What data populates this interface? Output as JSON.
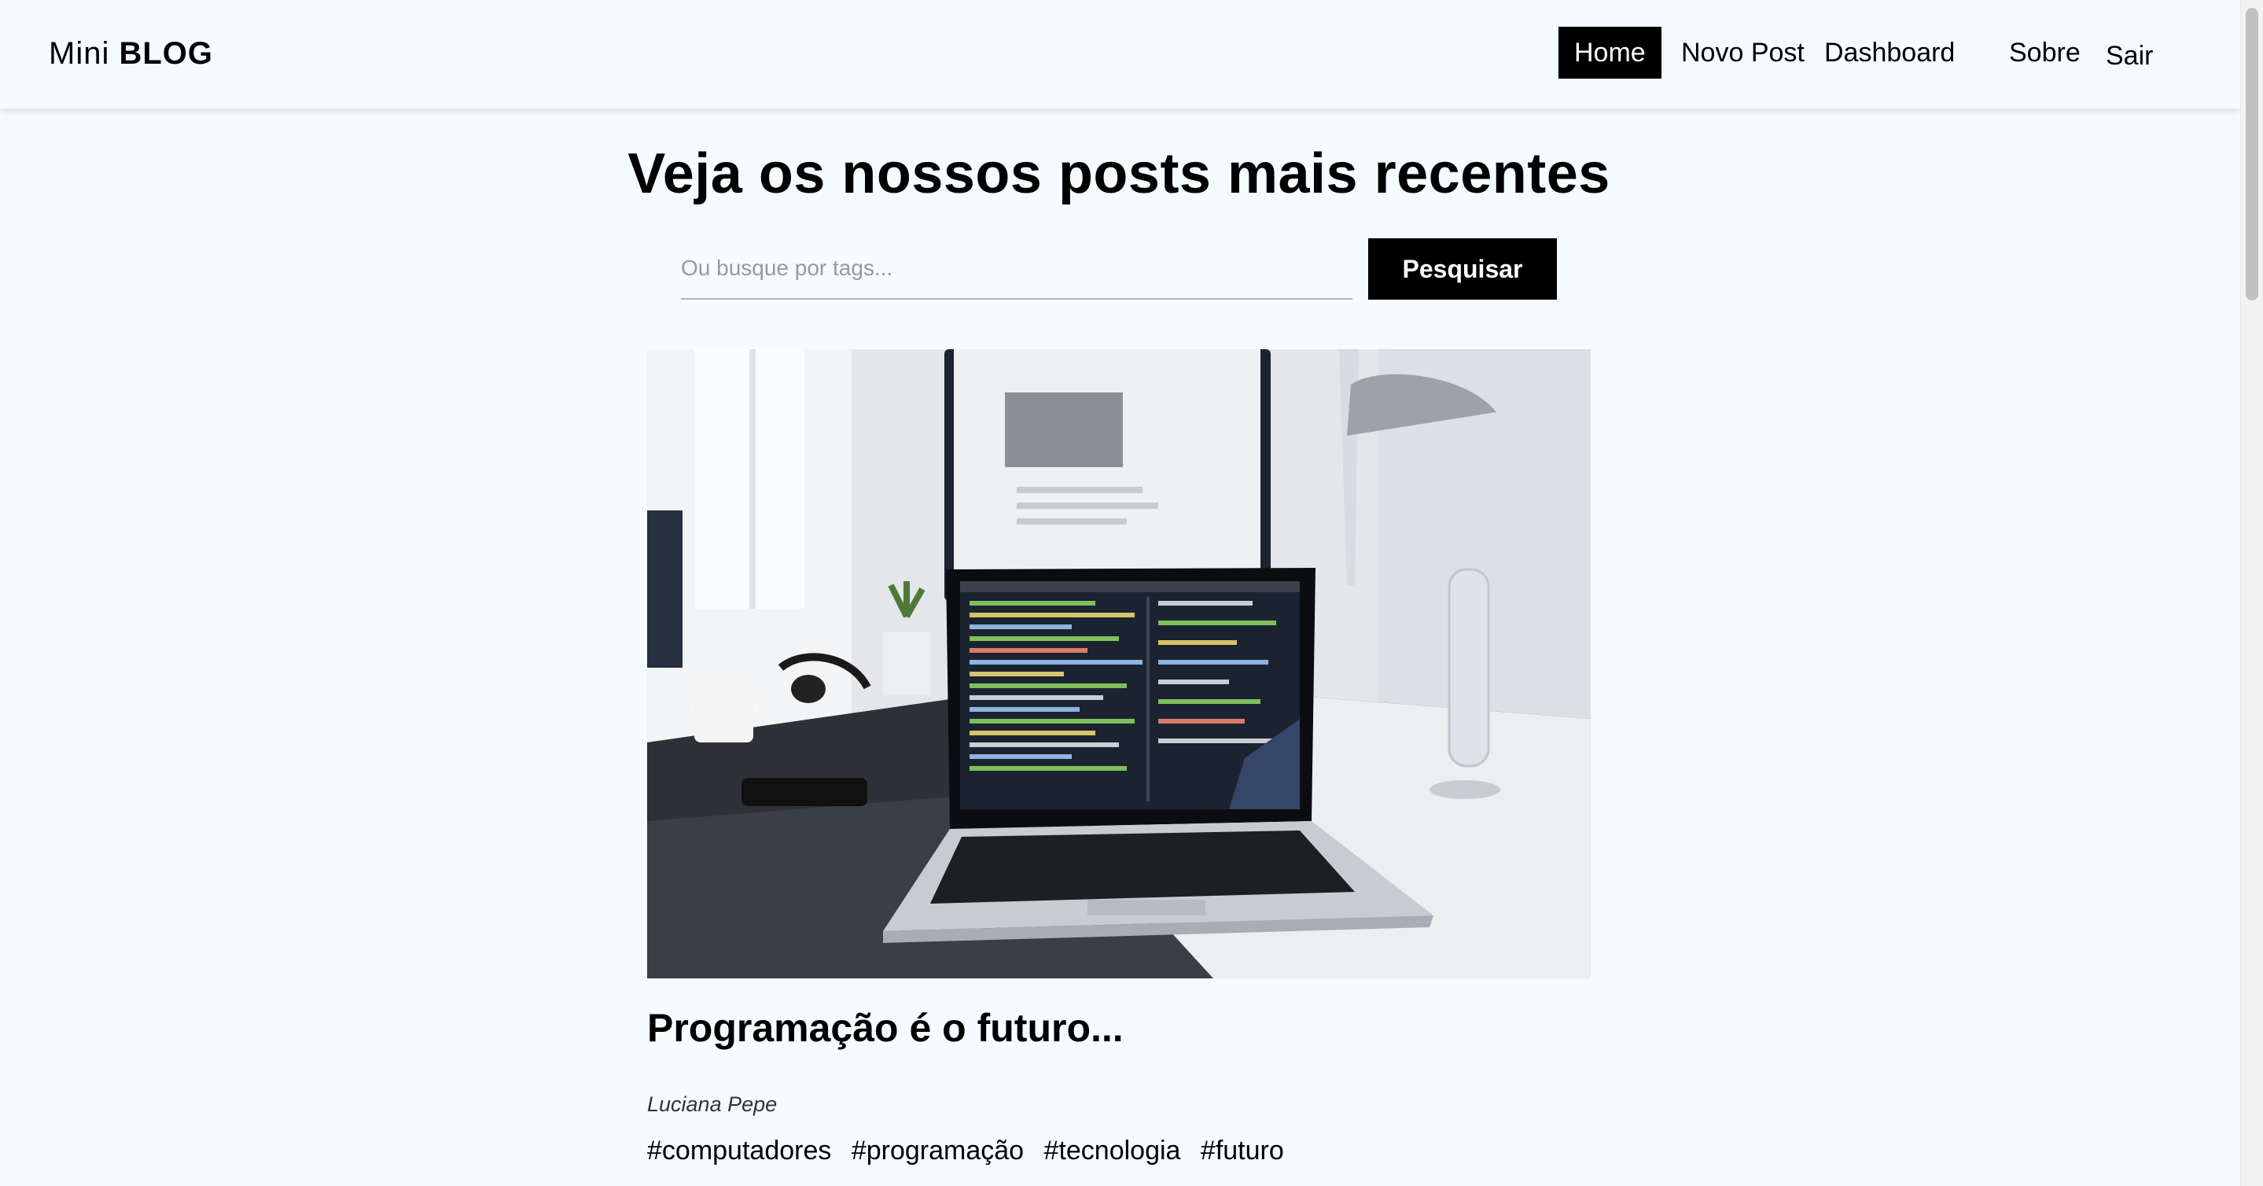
{
  "brand": {
    "prefix": "Mini",
    "strong": "BLOG"
  },
  "nav": {
    "home": "Home",
    "new_post": "Novo Post",
    "dashboard": "Dashboard",
    "about": "Sobre",
    "exit": "Sair",
    "active": "Home"
  },
  "main": {
    "title": "Veja os nossos posts mais recentes",
    "search": {
      "placeholder": "Ou busque por tags...",
      "value": "",
      "button_label": "Pesquisar"
    }
  },
  "posts": [
    {
      "title": "Programação é o futuro...",
      "author": "Luciana Pepe",
      "tags": [
        "#computadores",
        "#programação",
        "#tecnologia",
        "#futuro"
      ],
      "image": "desk-laptop-photo"
    }
  ],
  "colors": {
    "background": "#f5fbfe",
    "accent": "#000000",
    "accent_text": "#ffffff"
  }
}
